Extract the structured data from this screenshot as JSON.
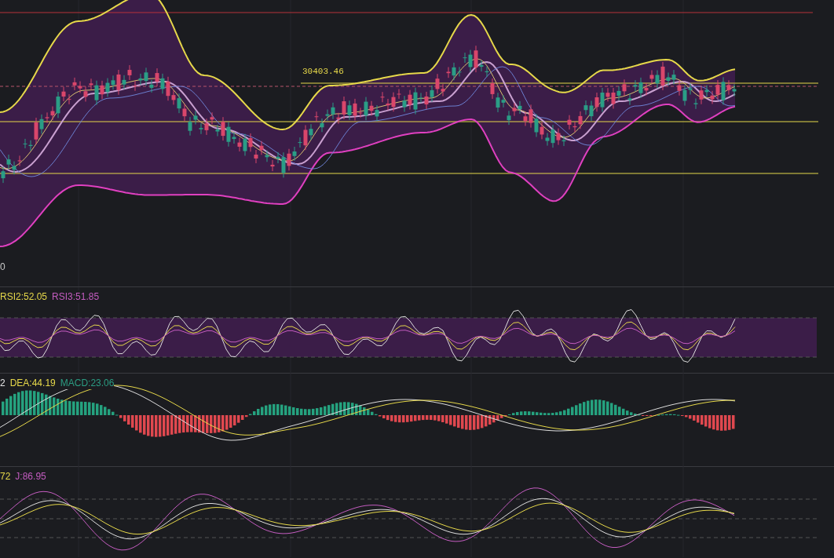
{
  "main_pane": {
    "price_label": "30403.46",
    "axis_label": "0"
  },
  "rsi_pane": {
    "legend": [
      {
        "text": "RSI2:52.05",
        "color": "#e6d84a"
      },
      {
        "text": "RSI3:51.85",
        "color": "#c45cc0"
      }
    ]
  },
  "macd_pane": {
    "legend": [
      {
        "text": "2",
        "color": "#e6e6e6"
      },
      {
        "text": "DEA:44.19",
        "color": "#e6d84a"
      },
      {
        "text": "MACD:23.06",
        "color": "#2b9c82"
      }
    ]
  },
  "kdj_pane": {
    "legend": [
      {
        "text": "72",
        "color": "#e6d84a"
      },
      {
        "text": "J:86.95",
        "color": "#c45cc0"
      }
    ]
  }
}
